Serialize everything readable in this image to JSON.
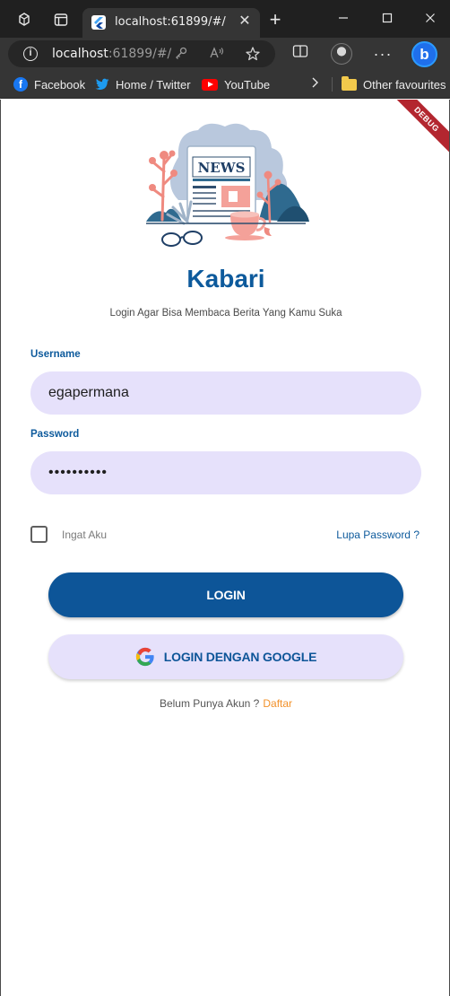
{
  "browser": {
    "tab_title": "localhost:61899/#/",
    "url_host": "localhost",
    "url_rest": ":61899/#/",
    "bookmarks": [
      {
        "label": "Facebook",
        "icon": "facebook-icon"
      },
      {
        "label": "Home / Twitter",
        "icon": "twitter-icon"
      },
      {
        "label": "YouTube",
        "icon": "youtube-icon"
      }
    ],
    "other_favourites": "Other favourites"
  },
  "app": {
    "debug_banner": "DEBUG",
    "title": "Kabari",
    "subtitle": "Login Agar Bisa Membaca Berita Yang Kamu Suka",
    "illustration_text": "NEWS"
  },
  "form": {
    "username_label": "Username",
    "username_value": "egapermana",
    "password_label": "Password",
    "password_value": "••••••••••",
    "remember_label": "Ingat Aku",
    "remember_checked": false,
    "forgot_password": "Lupa Password ?",
    "login_button": "LOGIN",
    "google_button": "LOGIN DENGAN GOOGLE",
    "no_account_text": "Belum Punya Akun ?",
    "register_link": "Daftar"
  },
  "colors": {
    "primary": "#0d5598",
    "input_fill": "#e6e1fb",
    "accent_link": "#f2912a",
    "debug_ribbon": "#b3262f"
  }
}
